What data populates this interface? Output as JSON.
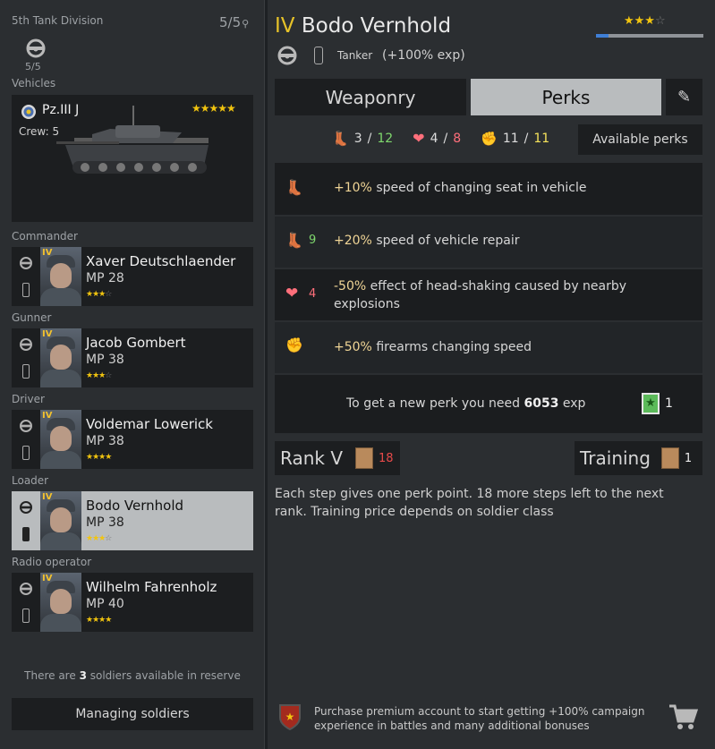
{
  "left": {
    "division": "5th Tank Division",
    "slots": "5/5",
    "vehicle_count": "5/5",
    "vehicles_label": "Vehicles",
    "vehicle": {
      "name": "Pz.III J",
      "crew": "Crew: 5",
      "stars": "★★★★★"
    },
    "crew": [
      {
        "role": "Commander",
        "name": "Xaver Deutschlaender",
        "mp": "MP 28",
        "rank": "IV",
        "stars": 3
      },
      {
        "role": "Gunner",
        "name": "Jacob Gombert",
        "mp": "MP 38",
        "rank": "IV",
        "stars": 3
      },
      {
        "role": "Driver",
        "name": "Voldemar Lowerick",
        "mp": "MP 38",
        "rank": "IV",
        "stars": 4
      },
      {
        "role": "Loader",
        "name": "Bodo Vernhold",
        "mp": "MP 38",
        "rank": "IV",
        "stars": 3
      },
      {
        "role": "Radio operator",
        "name": "Wilhelm Fahrenholz",
        "mp": "MP 40",
        "rank": "IV",
        "stars": 4
      }
    ],
    "reserve_pre": "There are",
    "reserve_count": "3",
    "reserve_post": "soldiers available in reserve",
    "managing_button": "Managing soldiers"
  },
  "right": {
    "rank": "IV",
    "name": "Bodo Vernhold",
    "stars": 3,
    "exp_progress": 0.12,
    "class": "Tanker",
    "bonus": "(+100% exp)",
    "tabs": {
      "weaponry": "Weaponry",
      "perks": "Perks"
    },
    "points": {
      "green_used": "3",
      "green_total": "12",
      "heart_used": "4",
      "heart_total": "8",
      "fist_used": "11",
      "fist_total": "11"
    },
    "available_perks_button": "Available perks",
    "perks": [
      {
        "cost": "",
        "value": "+10%",
        "text": "speed of changing seat in vehicle",
        "icon": "boot-icon"
      },
      {
        "cost": "9",
        "value": "+20%",
        "text": "speed of vehicle repair",
        "icon": "boot-icon"
      },
      {
        "cost": "4",
        "value": "-50%",
        "text": "effect of head-shaking caused by nearby explosions",
        "icon": "heart-icon"
      },
      {
        "cost": "",
        "value": "+50%",
        "text": "firearms changing speed",
        "icon": "fist-icon"
      }
    ],
    "new_perk_pre": "To get a new perk you need",
    "new_perk_exp": "6053",
    "new_perk_post": "exp",
    "perk_orders": "1",
    "rank_label": "Rank V",
    "rank_cost": "18",
    "training_label": "Training",
    "training_cost": "1",
    "description": "Each step gives one perk point. 18 more steps left to the next rank. Training price depends on soldier class",
    "premium_text": "Purchase premium account to start getting +100% campaign experience in battles and many additional bonuses"
  }
}
